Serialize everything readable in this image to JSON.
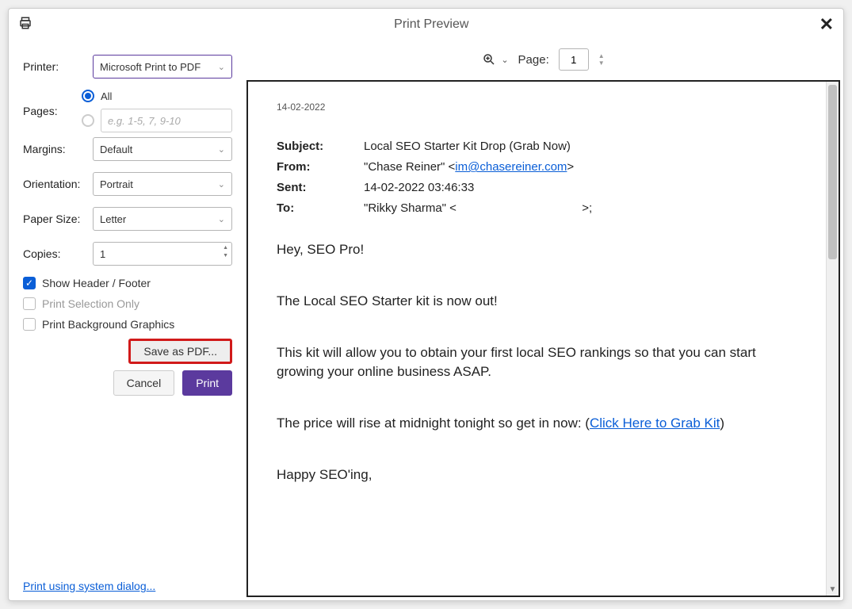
{
  "dialog": {
    "title": "Print Preview"
  },
  "sidebar": {
    "printer_label": "Printer:",
    "printer_value": "Microsoft Print to PDF",
    "pages_label": "Pages:",
    "pages_all_label": "All",
    "pages_range_placeholder": "e.g. 1-5, 7, 9-10",
    "margins_label": "Margins:",
    "margins_value": "Default",
    "orientation_label": "Orientation:",
    "orientation_value": "Portrait",
    "paper_label": "Paper Size:",
    "paper_value": "Letter",
    "copies_label": "Copies:",
    "copies_value": "1",
    "show_header_label": "Show Header / Footer",
    "print_selection_label": "Print Selection Only",
    "print_bg_label": "Print Background Graphics",
    "save_pdf_label": "Save as PDF...",
    "cancel_label": "Cancel",
    "print_label": "Print",
    "system_link": "Print using system dialog..."
  },
  "toolbar": {
    "page_label": "Page:",
    "page_value": "1"
  },
  "document": {
    "date": "14-02-2022",
    "subject_label": "Subject:",
    "subject_value": "Local SEO Starter Kit Drop (Grab Now)",
    "from_label": "From:",
    "from_name": "\"Chase Reiner\" <",
    "from_email": "im@chasereiner.com",
    "from_name_end": ">",
    "sent_label": "Sent:",
    "sent_value": "14-02-2022 03:46:33",
    "to_label": "To:",
    "to_value": "\"Rikky Sharma\" <                                      >;",
    "body": {
      "p1": "Hey, SEO Pro!",
      "p2": "The Local SEO Starter kit is now out!",
      "p3": "This kit will allow you to obtain your first local SEO rankings so that you can start growing your online business ASAP.",
      "p4_pre": "The price will rise at midnight tonight so get in now: (",
      "p4_link": "Click Here to Grab Kit",
      "p4_post": ")",
      "p5": "Happy SEO'ing,"
    }
  }
}
